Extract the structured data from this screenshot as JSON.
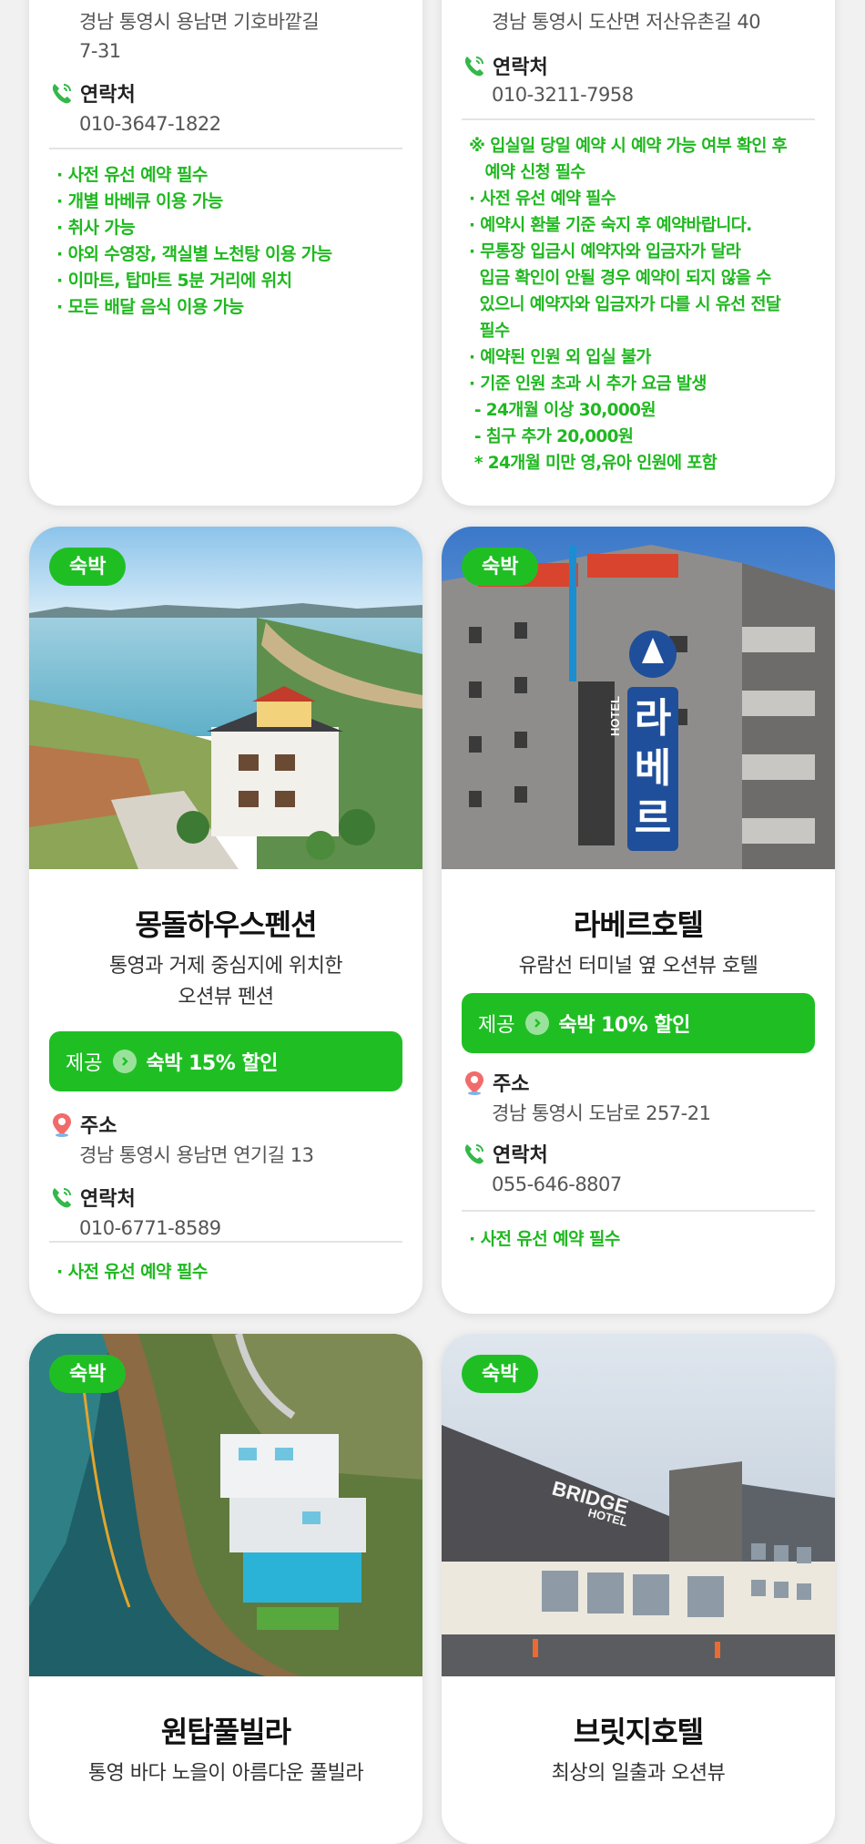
{
  "colors": {
    "accent": "#1fbf24",
    "note_green": "#1fb81f",
    "background": "#f1f1f1"
  },
  "cards": [
    {
      "address": [
        "경남 통영시 용남면 기호바깥길",
        "7-31"
      ],
      "contact_label": "연락처",
      "phone": "010-3647-1822",
      "notes": [
        "· 사전 유선 예약 필수",
        "· 개별 바베큐 이용 가능",
        "· 취사 가능",
        "· 야외 수영장, 객실별 노천탕 이용 가능",
        "· 이마트, 탑마트 5분 거리에 위치",
        "· 모든 배달 음식 이용 가능"
      ]
    },
    {
      "address": [
        "경남 통영시 도산면 저산유촌길 40"
      ],
      "contact_label": "연락처",
      "phone": "010-3211-7958",
      "notes": [
        "※ 입실일 당일 예약 시 예약 가능 여부 확인 후",
        "   예약 신청 필수",
        "· 사전 유선 예약 필수",
        "· 예약시 환불 기준 숙지 후 예약바랍니다.",
        "· 무통장 입금시 예약자와 입금자가 달라",
        "  입금 확인이 안될 경우 예약이 되지 않을 수",
        "  있으니 예약자와 입금자가 다를 시 유선 전달",
        "  필수",
        "· 예약된 인원 외 입실 불가",
        "· 기준 인원 초과 시 추가 요금 발생",
        " - 24개월 이상 30,000원",
        " - 침구 추가 20,000원",
        " * 24개월 미만 영,유아 인원에 포함"
      ]
    },
    {
      "badge": "숙박",
      "title": "몽돌하우스펜션",
      "subtitle": [
        "통영과 거제 중심지에 위치한",
        "오션뷰 펜션"
      ],
      "offer_provide": "제공",
      "offer_benefit": "숙박 15% 할인",
      "address_label": "주소",
      "address": [
        "경남 통영시 용남면 연기길 13"
      ],
      "contact_label": "연락처",
      "phone": "010-6771-8589",
      "notes": [
        "· 사전 유선 예약 필수"
      ],
      "photo_icon": "seaside-pension-photo"
    },
    {
      "badge": "숙박",
      "title": "라베르호텔",
      "subtitle": [
        "유람선 터미널 옆 오션뷰 호텔"
      ],
      "offer_provide": "제공",
      "offer_benefit": "숙박 10% 할인",
      "address_label": "주소",
      "address": [
        "경남 통영시 도남로 257-21"
      ],
      "contact_label": "연락처",
      "phone": "055-646-8807",
      "notes": [
        "· 사전 유선 예약 필수"
      ],
      "photo_icon": "hotel-building-photo",
      "sign_text": [
        "HOTEL",
        "라",
        "베",
        "르"
      ]
    },
    {
      "badge": "숙박",
      "title": "원탑풀빌라",
      "subtitle": [
        "통영 바다 노을이 아름다운 풀빌라"
      ],
      "photo_icon": "cliff-poolvilla-photo"
    },
    {
      "badge": "숙박",
      "title": "브릿지호텔",
      "subtitle": [
        "최상의 일출과 오션뷰"
      ],
      "photo_icon": "bridge-hotel-photo",
      "sign_text": [
        "BRIDGE",
        "HOTEL"
      ]
    }
  ]
}
